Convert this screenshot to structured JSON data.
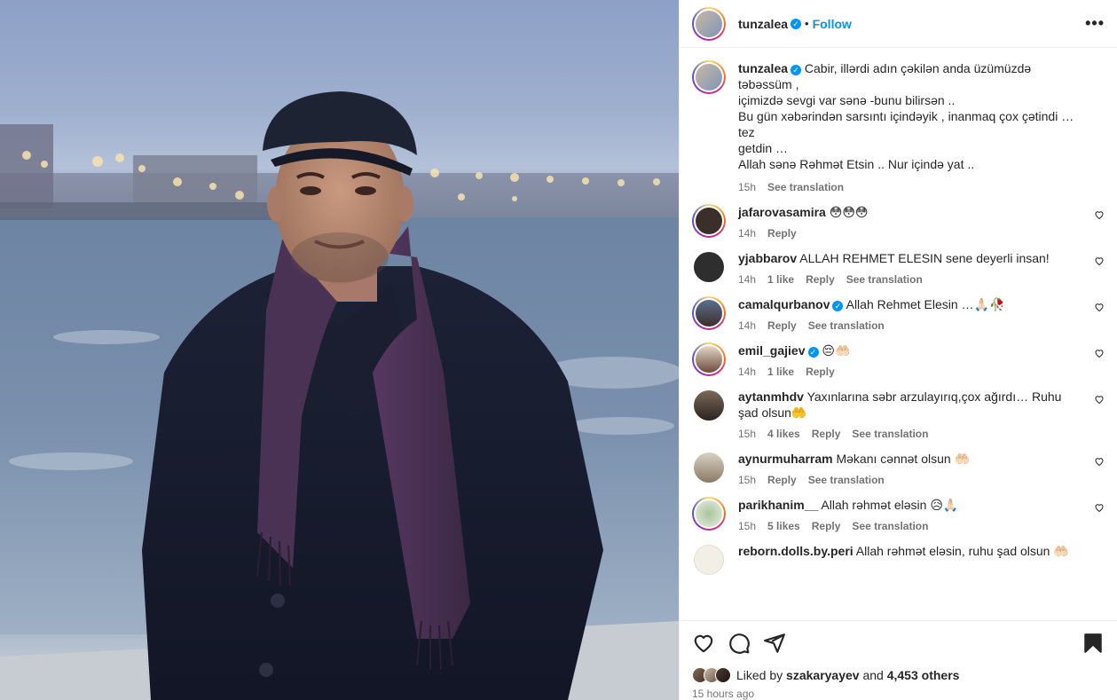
{
  "post": {
    "username": "tunzalea",
    "follow_label": "Follow",
    "more_label": "•••"
  },
  "caption": {
    "username": "tunzalea",
    "lines": [
      "Cabir, illərdi adın çəkilən anda üzümüzdə təbəssüm ,",
      "içimizdə sevgi var sənə -bunu bilirsən ..",
      "Bu gün xəbərindən sarsıntı içindəyik , inanmaq çox çətindi … tez",
      "getdin …",
      "Allah sənə Rəhmət Etsin .. Nur içində yat .."
    ],
    "time": "15h",
    "translate": "See translation"
  },
  "comments": [
    {
      "username": "jafarovasamira",
      "verified": false,
      "text": "😳😳😳",
      "time": "14h",
      "likes": "",
      "reply": "Reply",
      "translate": ""
    },
    {
      "username": "yjabbarov",
      "verified": false,
      "text": "ALLAH REHMET ELESIN sene deyerli insan!",
      "time": "14h",
      "likes": "1 like",
      "reply": "Reply",
      "translate": "See translation"
    },
    {
      "username": "camalqurbanov",
      "verified": true,
      "text": "Allah Rehmet Elesin …🙏🏻🥀",
      "time": "14h",
      "likes": "",
      "reply": "Reply",
      "translate": "See translation"
    },
    {
      "username": "emil_gajiev",
      "verified": true,
      "text": "😔🤲🏻",
      "time": "14h",
      "likes": "1 like",
      "reply": "Reply",
      "translate": ""
    },
    {
      "username": "aytanmhdv",
      "verified": false,
      "text": "Yaxınlarına səbr arzulayırıq,çox ağırdı… Ruhu şad olsun🤲",
      "time": "15h",
      "likes": "4 likes",
      "reply": "Reply",
      "translate": "See translation"
    },
    {
      "username": "aynurmuharram",
      "verified": false,
      "text": "Məkanı cənnət olsun 🤲🏻",
      "time": "15h",
      "likes": "",
      "reply": "Reply",
      "translate": "See translation"
    },
    {
      "username": "parikhanim__",
      "verified": false,
      "text": "Allah rəhmət eləsin 😥🙏🏻",
      "time": "15h",
      "likes": "5 likes",
      "reply": "Reply",
      "translate": "See translation"
    },
    {
      "username": "reborn.dolls.by.peri",
      "verified": false,
      "text": "Allah rəhmət eləsin, ruhu şad olsun 🤲🏻",
      "time": "",
      "likes": "",
      "reply": "",
      "translate": ""
    }
  ],
  "likes": {
    "prefix": "Liked by",
    "user": "szakaryayev",
    "and": "and",
    "others": "4,453 others"
  },
  "timestamp": "15 hours ago",
  "colors": {
    "link": "#0095f6",
    "secondary_text": "#737373",
    "border": "#efefef"
  }
}
